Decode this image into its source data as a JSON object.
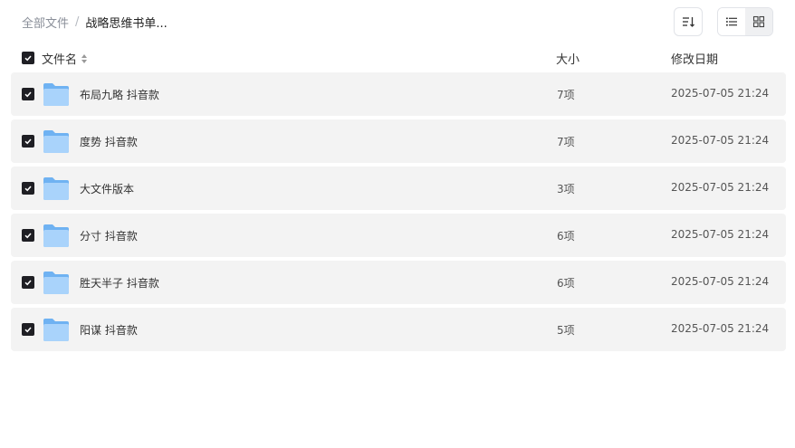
{
  "breadcrumb": {
    "root": "全部文件",
    "separator": "/",
    "current": "战略思维书单..."
  },
  "toolbar": {
    "sort_icon": "sort-icon",
    "list_view_icon": "list-view-icon",
    "grid_view_icon": "grid-view-icon",
    "active_view": "list"
  },
  "table": {
    "headers": {
      "name": "文件名",
      "size": "大小",
      "date": "修改日期"
    },
    "all_selected": true,
    "rows": [
      {
        "name": "布局九略 抖音款",
        "size": "7项",
        "date": "2025-07-05 21:24",
        "selected": true
      },
      {
        "name": "度势 抖音款",
        "size": "7项",
        "date": "2025-07-05 21:24",
        "selected": true
      },
      {
        "name": "大文件版本",
        "size": "3项",
        "date": "2025-07-05 21:24",
        "selected": true
      },
      {
        "name": "分寸 抖音款",
        "size": "6项",
        "date": "2025-07-05 21:24",
        "selected": true
      },
      {
        "name": "胜天半子 抖音款",
        "size": "6项",
        "date": "2025-07-05 21:24",
        "selected": true
      },
      {
        "name": "阳谋 抖音款",
        "size": "5项",
        "date": "2025-07-05 21:24",
        "selected": true
      }
    ]
  },
  "colors": {
    "row_background": "#f3f3f3",
    "checkbox": "#1f1f24",
    "folder_light": "#a9d3fb",
    "folder_dark": "#6fb2f2"
  }
}
